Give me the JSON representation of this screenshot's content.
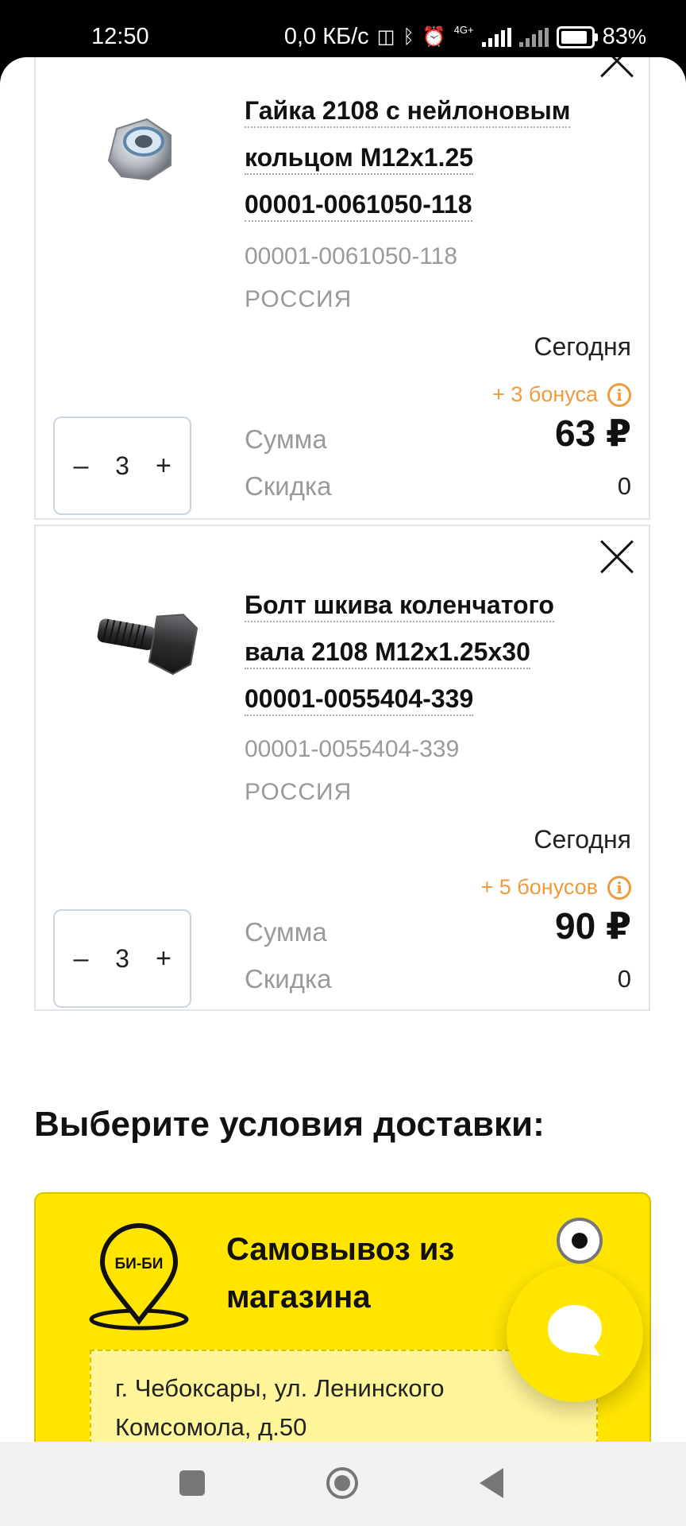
{
  "status_bar": {
    "time": "12:50",
    "network_speed": "0,0 КБ/с",
    "signal_label": "4G+",
    "battery": "83",
    "battery_unit": "%"
  },
  "cart": {
    "items": [
      {
        "title_lines": [
          "Гайка 2108 с нейлоновым",
          "кольцом М12х1.25",
          "00001-0061050-118"
        ],
        "article": "00001-0061050-118",
        "country": "РОССИЯ",
        "delivery": "Сегодня",
        "bonus": "+ 3 бонуса",
        "quantity": "3",
        "sum_label": "Сумма",
        "discount_label": "Скидка",
        "price": "63 ₽",
        "discount": "0"
      },
      {
        "title_lines": [
          "Болт шкива коленчатого",
          "вала 2108 М12х1.25х30",
          "00001-0055404-339"
        ],
        "article": "00001-0055404-339",
        "country": "РОССИЯ",
        "delivery": "Сегодня",
        "bonus": "+ 5 бонусов",
        "quantity": "3",
        "sum_label": "Сумма",
        "discount_label": "Скидка",
        "price": "90 ₽",
        "discount": "0"
      }
    ],
    "minus": "–",
    "plus": "+"
  },
  "delivery": {
    "heading": "Выберите условия доставки:",
    "option_title_lines": [
      "Самовывоз из",
      "магазина"
    ],
    "logo_text": "БИ-БИ",
    "address_lines": [
      "г. Чебоксары, ул. Ленинского",
      "Комсомола, д.50"
    ]
  },
  "colors": {
    "accent_yellow": "#ffe500",
    "bonus_orange": "#ef9a3c",
    "muted_text": "#9a9a9a"
  },
  "icons": [
    "close-icon",
    "info-icon",
    "map-pin-icon",
    "chat-icon",
    "nav-recents-icon",
    "nav-home-icon",
    "nav-back-icon"
  ]
}
